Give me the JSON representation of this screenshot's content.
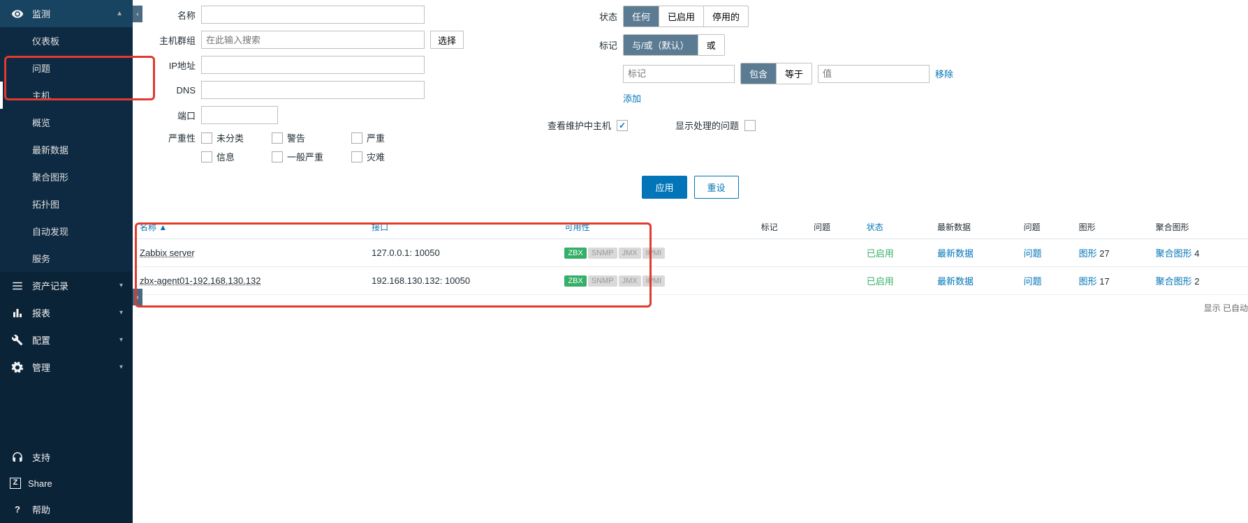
{
  "sidebar": {
    "sections": [
      {
        "label": "监测",
        "icon": "eye",
        "expanded": true,
        "items": [
          {
            "label": "仪表板"
          },
          {
            "label": "问题"
          },
          {
            "label": "主机",
            "active": true
          },
          {
            "label": "概览"
          },
          {
            "label": "最新数据"
          },
          {
            "label": "聚合图形"
          },
          {
            "label": "拓扑图"
          },
          {
            "label": "自动发现"
          },
          {
            "label": "服务"
          }
        ]
      },
      {
        "label": "资产记录",
        "icon": "list"
      },
      {
        "label": "报表",
        "icon": "bar"
      },
      {
        "label": "配置",
        "icon": "wrench"
      },
      {
        "label": "管理",
        "icon": "gear"
      }
    ],
    "bottom": [
      {
        "label": "支持",
        "icon": "headset"
      },
      {
        "label": "Share",
        "icon": "z"
      },
      {
        "label": "帮助",
        "icon": "question"
      }
    ]
  },
  "filter": {
    "name_label": "名称",
    "hostgroup_label": "主机群组",
    "hostgroup_placeholder": "在此输入搜索",
    "select_btn": "选择",
    "ip_label": "IP地址",
    "dns_label": "DNS",
    "port_label": "端口",
    "severity_label": "严重性",
    "severities": [
      [
        "未分类",
        "信息"
      ],
      [
        "警告",
        "一般严重"
      ],
      [
        "严重",
        "灾难"
      ]
    ],
    "status_label": "状态",
    "status_opts": [
      "任何",
      "已启用",
      "停用的"
    ],
    "tag_label": "标记",
    "tag_opts": [
      "与/或（默认）",
      "或"
    ],
    "tag_placeholder": "标记",
    "tag_mode_opts": [
      "包含",
      "等于"
    ],
    "tag_value_placeholder": "值",
    "remove_link": "移除",
    "add_link": "添加",
    "maint_label": "查看维护中主机",
    "supp_label": "显示处理的问题",
    "apply_btn": "应用",
    "reset_btn": "重设"
  },
  "table": {
    "headers": {
      "name": "名称",
      "interface": "接口",
      "availability": "可用性",
      "tags": "标记",
      "problems": "问题",
      "status": "状态",
      "latest": "最新数据",
      "problems2": "问题",
      "graphs": "图形",
      "screens": "聚合图形"
    },
    "sort_indicator": "▲",
    "rows": [
      {
        "name": "Zabbix server",
        "interface": "127.0.0.1: 10050",
        "status": "已启用",
        "latest": "最新数据",
        "problems": "问题",
        "graphs_label": "图形",
        "graphs_count": "27",
        "screens_label": "聚合图形",
        "screens_count": "4"
      },
      {
        "name": "zbx-agent01-192.168.130.132",
        "interface": "192.168.130.132: 10050",
        "status": "已启用",
        "latest": "最新数据",
        "problems": "问题",
        "graphs_label": "图形",
        "graphs_count": "17",
        "screens_label": "聚合图形",
        "screens_count": "2"
      }
    ],
    "avail_badges": [
      "ZBX",
      "SNMP",
      "JMX",
      "IPMI"
    ],
    "footer": "显示 已自动"
  }
}
